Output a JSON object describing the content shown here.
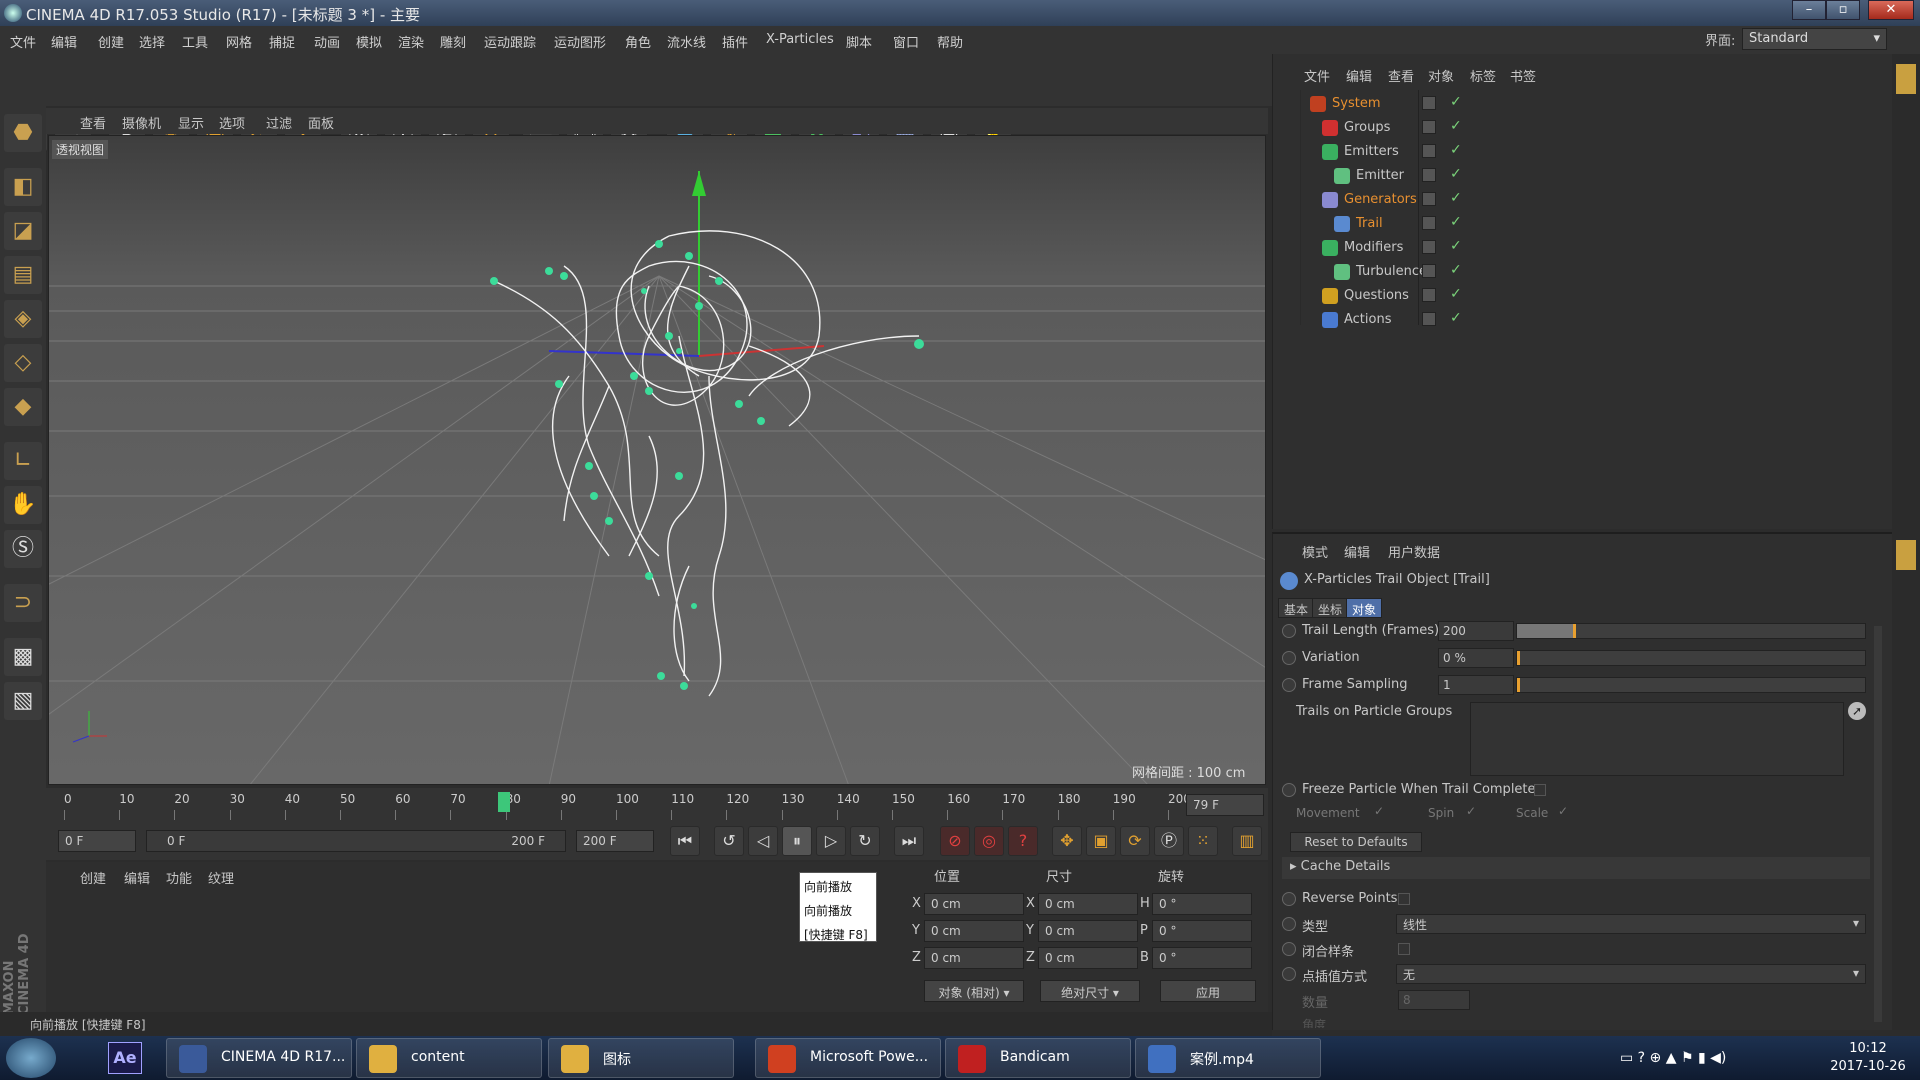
{
  "window": {
    "title": "CINEMA 4D R17.053 Studio (R17) - [未标题 3 *] - 主要"
  },
  "menu": [
    "文件",
    "编辑",
    "创建",
    "选择",
    "工具",
    "网格",
    "捕捉",
    "动画",
    "模拟",
    "渲染",
    "雕刻",
    "运动跟踪",
    "运动图形",
    "角色",
    "流水线",
    "插件",
    "X-Particles",
    "脚本",
    "窗口",
    "帮助"
  ],
  "interface": {
    "label": "界面:",
    "value": "Standard"
  },
  "viewport": {
    "menu": [
      "查看",
      "摄像机",
      "显示",
      "选项",
      "过滤",
      "面板"
    ],
    "title": "透视视图",
    "grid_spacing": "网格间距 : 100 cm"
  },
  "timeline": {
    "ticks": [
      "0",
      "10",
      "20",
      "30",
      "40",
      "50",
      "60",
      "70",
      "80",
      "90",
      "100",
      "110",
      "120",
      "130",
      "140",
      "150",
      "160",
      "170",
      "180",
      "190",
      "200"
    ],
    "current_frame_field": "79 F",
    "current_frame": 79,
    "max_frame": 200
  },
  "transport": {
    "start": "0 F",
    "range_start": "0 F",
    "range_end": "200 F",
    "end": "200 F"
  },
  "tooltip": {
    "line1": "向前播放",
    "line2": "向前播放",
    "line3": "[快捷键 F8]"
  },
  "material": {
    "menu": [
      "创建",
      "编辑",
      "功能",
      "纹理"
    ]
  },
  "maxon_brand": "MAXON CINEMA 4D",
  "coords": {
    "headers": [
      "位置",
      "尺寸",
      "旋转"
    ],
    "rows": [
      {
        "axis": "X",
        "pos": "0 cm",
        "size_axis": "X",
        "size": "0 cm",
        "rot_axis": "H",
        "rot": "0 °"
      },
      {
        "axis": "Y",
        "pos": "0 cm",
        "size_axis": "Y",
        "size": "0 cm",
        "rot_axis": "P",
        "rot": "0 °"
      },
      {
        "axis": "Z",
        "pos": "0 cm",
        "size_axis": "Z",
        "size": "0 cm",
        "rot_axis": "B",
        "rot": "0 °"
      }
    ],
    "mode": "对象 (相对)",
    "size_mode": "绝对尺寸",
    "apply": "应用"
  },
  "status": "向前播放 [快捷键 F8]",
  "object_manager": {
    "menu": [
      "文件",
      "编辑",
      "查看",
      "对象",
      "标签",
      "书签"
    ],
    "items": [
      {
        "label": "System",
        "color": "#e89030",
        "icon": "#c04020"
      },
      {
        "label": "Groups",
        "color": "#c8c8c8",
        "icon": "#d03030"
      },
      {
        "label": "Emitters",
        "color": "#c8c8c8",
        "icon": "#3ab060"
      },
      {
        "label": "Emitter",
        "color": "#c8c8c8",
        "icon": "#60c080"
      },
      {
        "label": "Generators",
        "color": "#e89030",
        "icon": "#8a8ad0"
      },
      {
        "label": "Trail",
        "color": "#e89030",
        "icon": "#5a8ad0"
      },
      {
        "label": "Modifiers",
        "color": "#c8c8c8",
        "icon": "#3ab060"
      },
      {
        "label": "Turbulence",
        "color": "#c8c8c8",
        "icon": "#60c080"
      },
      {
        "label": "Questions",
        "color": "#c8c8c8",
        "icon": "#d0a020"
      },
      {
        "label": "Actions",
        "color": "#c8c8c8",
        "icon": "#4a7ad0"
      }
    ]
  },
  "attributes": {
    "menu": [
      "模式",
      "编辑",
      "用户数据"
    ],
    "title": "X-Particles Trail Object [Trail]",
    "tabs": [
      "基本",
      "坐标",
      "对象"
    ],
    "trail_length": {
      "label": "Trail Length (Frames)",
      "value": "200",
      "slider": 0.16
    },
    "variation": {
      "label": "Variation",
      "value": "0 %",
      "slider": 0.0
    },
    "frame_sampling": {
      "label": "Frame Sampling",
      "value": "1",
      "slider": 0.0
    },
    "trails_on_groups": "Trails on Particle Groups",
    "freeze": "Freeze Particle When Trail Complete",
    "movement": "Movement",
    "spin": "Spin",
    "scale": "Scale",
    "reset": "Reset to Defaults",
    "cache": "Cache Details",
    "reverse": "Reverse Points",
    "type_label": "类型",
    "type_value": "线性",
    "closed_label": "闭合样条",
    "interp_label": "点插值方式",
    "interp_value": "无",
    "count_label": "数量",
    "count_value": "8",
    "extra_label": "角度"
  },
  "taskbar": {
    "tasks": [
      {
        "label": "CINEMA 4D R17...",
        "color": "#3a5a9a"
      },
      {
        "label": "content",
        "color": "#e0b040"
      },
      {
        "label": "图标",
        "color": "#e0b040"
      },
      {
        "label": "Microsoft Powe...",
        "color": "#d04020"
      },
      {
        "label": "Bandicam",
        "color": "#c02020"
      },
      {
        "label": "案例.mp4",
        "color": "#4070c0"
      }
    ],
    "time": "10:12",
    "date": "2017-10-26"
  }
}
